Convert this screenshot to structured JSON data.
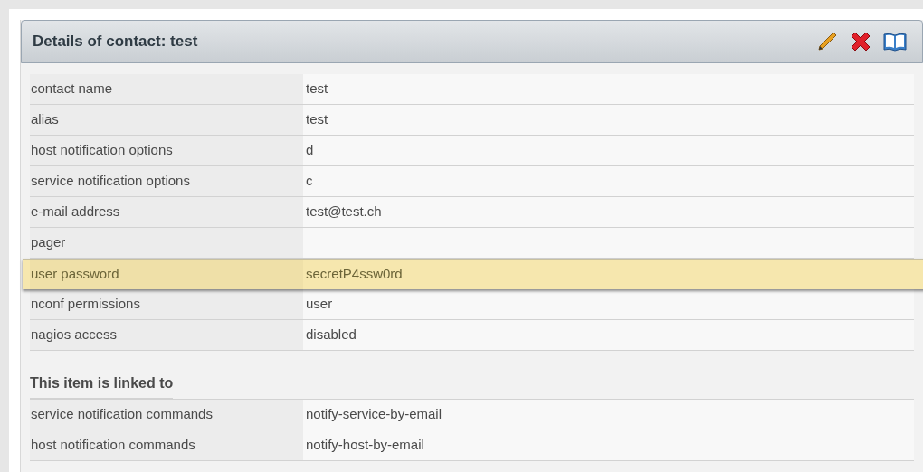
{
  "panel": {
    "title": "Details of contact: test"
  },
  "toolbar": [
    {
      "kind": "edit"
    },
    {
      "kind": "delete"
    },
    {
      "kind": "help"
    }
  ],
  "attributes": [
    {
      "label": "contact name",
      "value": "test",
      "selected": false
    },
    {
      "label": "alias",
      "value": "test",
      "selected": false
    },
    {
      "label": "host notification options",
      "value": "d",
      "selected": false
    },
    {
      "label": "service notification options",
      "value": "c",
      "selected": false
    },
    {
      "label": "e-mail address",
      "value": "test@test.ch",
      "selected": false
    },
    {
      "label": "pager",
      "selected": false
    },
    {
      "label": "user password",
      "value": "secretP4ssw0rd",
      "selected": true
    },
    {
      "label": "nconf permissions",
      "value": "user",
      "selected": false
    },
    {
      "label": "nagios access",
      "value": "disabled",
      "selected": false
    }
  ],
  "linked": {
    "heading": "This item is linked to",
    "rows": [
      {
        "label": "service notification commands",
        "value": "notify-service-by-email"
      },
      {
        "label": "host notification commands",
        "value": "notify-host-by-email"
      }
    ]
  }
}
